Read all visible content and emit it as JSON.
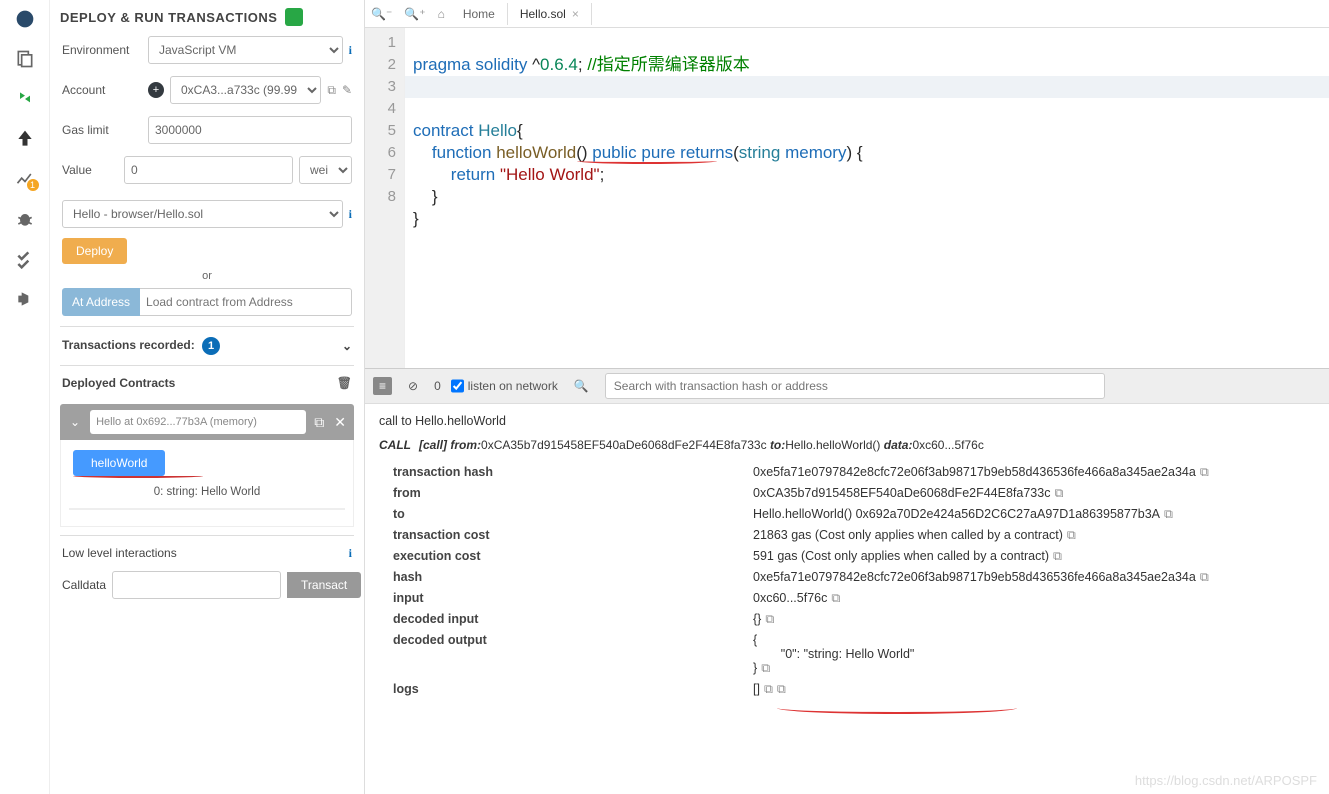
{
  "title": "DEPLOY & RUN TRANSACTIONS",
  "env": {
    "label": "Environment",
    "value": "JavaScript VM"
  },
  "account": {
    "label": "Account",
    "value": "0xCA3...a733c (99.99"
  },
  "gas": {
    "label": "Gas limit",
    "value": "3000000"
  },
  "value": {
    "label": "Value",
    "amount": "0",
    "unit": "wei"
  },
  "contract": "Hello - browser/Hello.sol",
  "deploy": "Deploy",
  "or": "or",
  "ataddr": "At Address",
  "ataddr_ph": "Load contract from Address",
  "recorded": {
    "label": "Transactions recorded:",
    "count": "1"
  },
  "deployed": {
    "label": "Deployed Contracts",
    "item": "Hello at 0x692...77b3A (memory)"
  },
  "callbtn": "helloWorld",
  "ret": "0: string: Hello World",
  "lowlevel": "Low level interactions",
  "calldata": "Calldata",
  "transact": "Transact",
  "tabs": {
    "home": "Home",
    "file": "Hello.sol"
  },
  "code": {
    "l1a": "pragma",
    "l1b": "solidity",
    "l1c": "^0.6.4",
    "l1d": "//指定所需编译器版本",
    "l4a": "contract",
    "l4b": "Hello",
    "l5a": "function",
    "l5b": "helloWorld",
    "l5c": "public",
    "l5d": "pure",
    "l5e": "returns",
    "l5f": "string",
    "l5g": "memory",
    "l6a": "return",
    "l6b": "\"Hello World\""
  },
  "term": {
    "count": "0",
    "listen": "listen on network",
    "search_ph": "Search with transaction hash or address",
    "callto": "call to Hello.helloWorld",
    "tag": "CALL",
    "bracket": "[call]",
    "from": "0xCA35b7d915458EF540aDe6068dFe2F44E8fa733c",
    "to": "Hello.helloWorld()",
    "data": "0xc60...5f76c"
  },
  "tx": {
    "k1": "transaction hash",
    "v1": "0xe5fa71e0797842e8cfc72e06f3ab98717b9eb58d436536fe466a8a345ae2a34a",
    "k2": "from",
    "v2": "0xCA35b7d915458EF540aDe6068dFe2F44E8fa733c",
    "k3": "to",
    "v3": "Hello.helloWorld() 0x692a70D2e424a56D2C6C27aA97D1a86395877b3A",
    "k4": "transaction cost",
    "v4": "21863 gas (Cost only applies when called by a contract)",
    "k5": "execution cost",
    "v5": "591 gas (Cost only applies when called by a contract)",
    "k6": "hash",
    "v6": "0xe5fa71e0797842e8cfc72e06f3ab98717b9eb58d436536fe466a8a345ae2a34a",
    "k7": "input",
    "v7": "0xc60...5f76c",
    "k8": "decoded input",
    "v8": "{}",
    "k9": "decoded output",
    "v9a": "{",
    "v9b": "\"0\": \"string: Hello World\"",
    "v9c": "}",
    "k10": "logs",
    "v10": "[]"
  },
  "watermark": "https://blog.csdn.net/ARPOSPF"
}
